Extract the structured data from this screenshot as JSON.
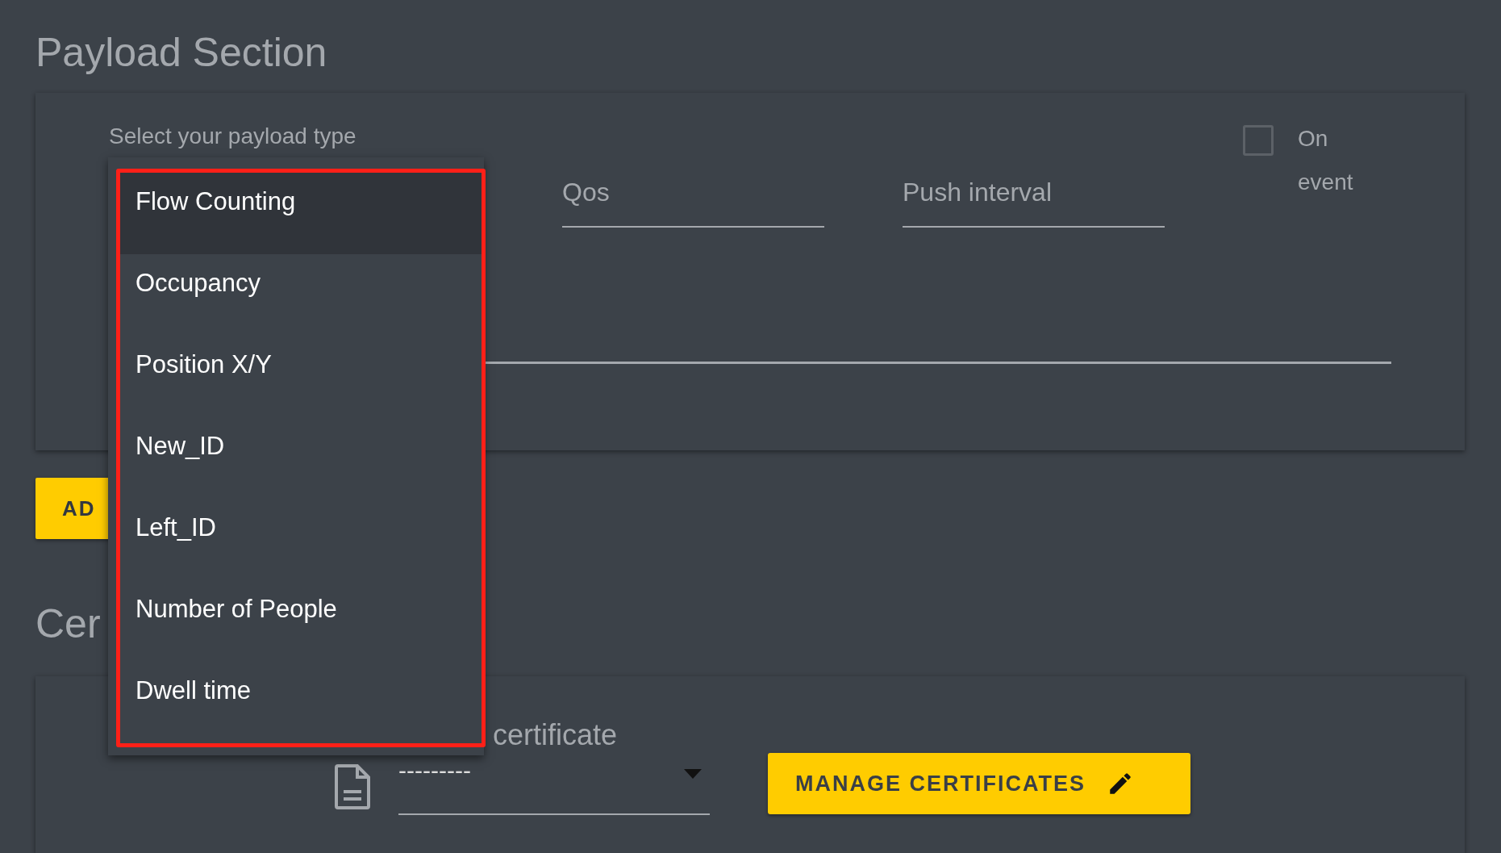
{
  "page_title": "Payload Section",
  "payload_card": {
    "payload_type": {
      "label": "Select your payload type"
    },
    "qos": {
      "placeholder": "Qos"
    },
    "push_interval": {
      "placeholder": "Push interval"
    },
    "on_event": {
      "label": "On event",
      "checked": false
    }
  },
  "add_button": "AD",
  "certificates_heading": "Cer",
  "certificate_card": {
    "certificate": {
      "label": "certificate",
      "value": "---------"
    },
    "manage_button": "MANAGE CERTIFICATES"
  },
  "dropdown": {
    "options": [
      {
        "label": "Flow Counting",
        "selected": true
      },
      {
        "label": "Occupancy",
        "selected": false
      },
      {
        "label": "Position X/Y",
        "selected": false
      },
      {
        "label": "New_ID",
        "selected": false
      },
      {
        "label": "Left_ID",
        "selected": false
      },
      {
        "label": "Number of People",
        "selected": false
      },
      {
        "label": "Dwell time",
        "selected": false
      }
    ]
  }
}
